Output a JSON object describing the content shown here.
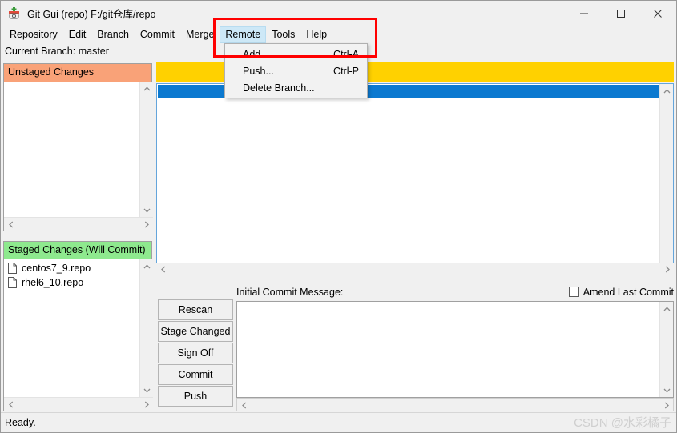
{
  "window": {
    "title": "Git Gui (repo) F:/git仓库/repo",
    "icon": "git-gui-icon",
    "controls": {
      "minimize": "minimize-icon",
      "maximize": "maximize-icon",
      "close": "close-icon"
    }
  },
  "menubar": {
    "items": [
      {
        "label": "Repository",
        "active": false
      },
      {
        "label": "Edit",
        "active": false
      },
      {
        "label": "Branch",
        "active": false
      },
      {
        "label": "Commit",
        "active": false
      },
      {
        "label": "Merge",
        "active": false
      },
      {
        "label": "Remote",
        "active": true
      },
      {
        "label": "Tools",
        "active": false
      },
      {
        "label": "Help",
        "active": false
      }
    ]
  },
  "dropdown": {
    "owner": "Remote",
    "items": [
      {
        "label": "Add...",
        "accel": "Ctrl-A"
      },
      {
        "label": "Push...",
        "accel": "Ctrl-P"
      },
      {
        "label": "Delete Branch...",
        "accel": ""
      }
    ]
  },
  "branch_line": "Current Branch: master",
  "panels": {
    "unstaged": {
      "title": "Unstaged Changes",
      "header_color": "#f9a278",
      "files": []
    },
    "staged": {
      "title": "Staged Changes (Will Commit)",
      "header_color": "#8ee98e",
      "files": [
        {
          "name": "centos7_9.repo",
          "icon": "file-icon"
        },
        {
          "name": "rhel6_10.repo",
          "icon": "file-icon"
        }
      ]
    }
  },
  "buttons": [
    {
      "label": "Rescan"
    },
    {
      "label": "Stage Changed"
    },
    {
      "label": "Sign Off"
    },
    {
      "label": "Commit"
    },
    {
      "label": "Push"
    }
  ],
  "diff_view": {
    "highlight_bar_color": "#ffd100",
    "selection_bar_color": "#0b79d0",
    "content": ""
  },
  "commit": {
    "label": "Initial Commit Message:",
    "amend_label": "Amend Last Commit",
    "amend_checked": false,
    "message_value": "",
    "message_placeholder": ""
  },
  "statusbar": {
    "text": "Ready.",
    "watermark": "CSDN @水彩橘子"
  },
  "annotation": {
    "color": "#ff0000",
    "target": "Remote menu and Add... item"
  },
  "icons": {
    "scroll_up": "▲",
    "scroll_down": "▼",
    "scroll_left": "‹",
    "scroll_right": "›"
  }
}
